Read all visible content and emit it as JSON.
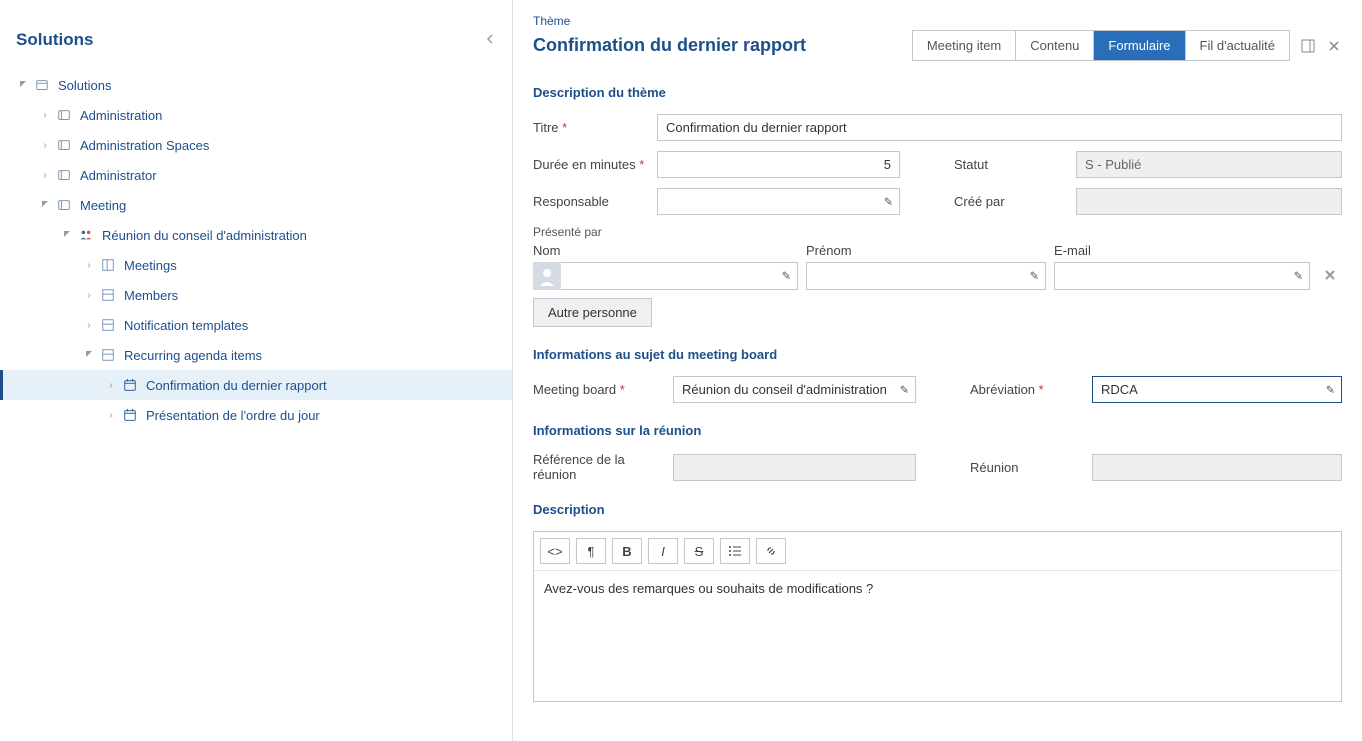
{
  "sidebar": {
    "title": "Solutions",
    "tree": {
      "root": {
        "label": "Solutions"
      },
      "items": [
        {
          "label": "Administration"
        },
        {
          "label": "Administration Spaces"
        },
        {
          "label": "Administrator"
        },
        {
          "label": "Meeting"
        }
      ],
      "meeting_board": {
        "label": "Réunion du conseil d'administration"
      },
      "board_items": [
        {
          "label": "Meetings"
        },
        {
          "label": "Members"
        },
        {
          "label": "Notification templates"
        },
        {
          "label": "Recurring agenda items"
        }
      ],
      "agenda_items": [
        {
          "label": "Confirmation du dernier rapport"
        },
        {
          "label": "Présentation de l'ordre du jour"
        }
      ]
    }
  },
  "header": {
    "breadcrumb": "Thème",
    "title": "Confirmation du dernier rapport",
    "tabs": [
      {
        "label": "Meeting item"
      },
      {
        "label": "Contenu"
      },
      {
        "label": "Formulaire"
      },
      {
        "label": "Fil d'actualité"
      }
    ]
  },
  "form": {
    "section1": "Description du thème",
    "titre_label": "Titre",
    "titre_value": "Confirmation du dernier rapport",
    "duree_label": "Durée en minutes",
    "duree_value": "5",
    "statut_label": "Statut",
    "statut_value": "S - Publié",
    "responsable_label": "Responsable",
    "responsable_value": "",
    "creepar_label": "Créé par",
    "creepar_value": "",
    "presente_label": "Présenté par",
    "nom_label": "Nom",
    "prenom_label": "Prénom",
    "email_label": "E-mail",
    "autre_personne": "Autre personne",
    "section2": "Informations au sujet du meeting board",
    "mb_label": "Meeting board",
    "mb_value": "Réunion du conseil d'administration",
    "abrev_label": "Abréviation",
    "abrev_value": "RDCA",
    "section3": "Informations sur la réunion",
    "ref_label": "Référence de la réunion",
    "ref_value": "",
    "reunion_label": "Réunion",
    "reunion_value": "",
    "section4": "Description",
    "description_text": "Avez-vous des remarques ou souhaits de modifications ?"
  }
}
